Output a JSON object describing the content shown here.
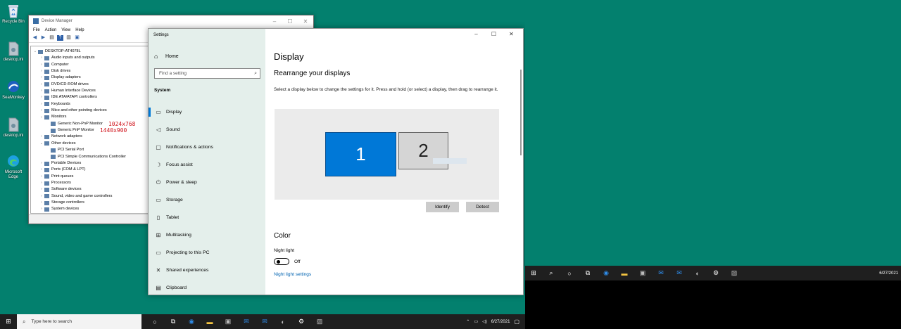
{
  "desktop": {
    "icons": [
      {
        "label": "Recycle Bin",
        "icon": "recycle-bin-icon"
      },
      {
        "label": "desktop.ini",
        "icon": "file-icon"
      },
      {
        "label": "SeaMonkey",
        "icon": "seamonkey-icon"
      },
      {
        "label": "desktop.ini",
        "icon": "file-icon"
      },
      {
        "label": "Microsoft Edge",
        "icon": "edge-icon"
      }
    ]
  },
  "device_manager": {
    "title": "Device Manager",
    "menu": [
      "File",
      "Action",
      "View",
      "Help"
    ],
    "tree": {
      "root": "DESKTOP-AT4078L",
      "items": [
        {
          "label": "Audio inputs and outputs",
          "expanded": false
        },
        {
          "label": "Computer",
          "expanded": false
        },
        {
          "label": "Disk drives",
          "expanded": false
        },
        {
          "label": "Display adapters",
          "expanded": false
        },
        {
          "label": "DVD/CD-ROM drives",
          "expanded": false
        },
        {
          "label": "Human Interface Devices",
          "expanded": false
        },
        {
          "label": "IDE ATA/ATAPI controllers",
          "expanded": false
        },
        {
          "label": "Keyboards",
          "expanded": false
        },
        {
          "label": "Mice and other pointing devices",
          "expanded": false
        },
        {
          "label": "Monitors",
          "expanded": true
        },
        {
          "label": "Generic Non-PnP Monitor",
          "child": true,
          "res": "1024x768"
        },
        {
          "label": "Generic PnP Monitor",
          "child": true,
          "res": "1440x900"
        },
        {
          "label": "Network adapters",
          "expanded": false
        },
        {
          "label": "Other devices",
          "expanded": true
        },
        {
          "label": "PCI Serial Port",
          "child": true
        },
        {
          "label": "PCI Simple Communications Controller",
          "child": true
        },
        {
          "label": "Portable Devices",
          "expanded": false
        },
        {
          "label": "Ports (COM & LPT)",
          "expanded": false
        },
        {
          "label": "Print queues",
          "expanded": false
        },
        {
          "label": "Processors",
          "expanded": false
        },
        {
          "label": "Software devices",
          "expanded": false
        },
        {
          "label": "Sound, video and game controllers",
          "expanded": false
        },
        {
          "label": "Storage controllers",
          "expanded": false
        },
        {
          "label": "System devices",
          "expanded": false
        }
      ]
    }
  },
  "settings": {
    "window_title": "Settings",
    "nav": {
      "home": "Home",
      "search_placeholder": "Find a setting",
      "section": "System",
      "items": [
        {
          "label": "Display",
          "icon": "monitor-icon",
          "glyph": "▭",
          "active": true
        },
        {
          "label": "Sound",
          "icon": "speaker-icon",
          "glyph": "◁",
          "active": false
        },
        {
          "label": "Notifications & actions",
          "icon": "notification-icon",
          "glyph": "▢",
          "active": false
        },
        {
          "label": "Focus assist",
          "icon": "moon-icon",
          "glyph": "☽",
          "active": false
        },
        {
          "label": "Power & sleep",
          "icon": "power-icon",
          "glyph": "⏻",
          "active": false
        },
        {
          "label": "Storage",
          "icon": "storage-icon",
          "glyph": "▭",
          "active": false
        },
        {
          "label": "Tablet",
          "icon": "tablet-icon",
          "glyph": "▯",
          "active": false
        },
        {
          "label": "Multitasking",
          "icon": "multitasking-icon",
          "glyph": "⊞",
          "active": false
        },
        {
          "label": "Projecting to this PC",
          "icon": "projecting-icon",
          "glyph": "▭",
          "active": false
        },
        {
          "label": "Shared experiences",
          "icon": "shared-icon",
          "glyph": "✕",
          "active": false
        },
        {
          "label": "Clipboard",
          "icon": "clipboard-icon",
          "glyph": "▤",
          "active": false
        }
      ]
    },
    "content": {
      "title": "Display",
      "subtitle": "Rearrange your displays",
      "description": "Select a display below to change the settings for it. Press and hold (or select) a display, then drag to rearrange it.",
      "display_1": "1",
      "display_2": "2",
      "identify_label": "Identify",
      "detect_label": "Detect",
      "color_heading": "Color",
      "night_light_label": "Night light",
      "night_light_state": "Off",
      "night_light_link": "Night light settings"
    }
  },
  "taskbar": {
    "search_placeholder": "Type here to search",
    "date": "6/27/2021",
    "pinned": [
      {
        "icon": "cortana-icon",
        "glyph": "○"
      },
      {
        "icon": "task-view-icon",
        "glyph": "⧉"
      },
      {
        "icon": "edge-icon",
        "glyph": "◉"
      },
      {
        "icon": "file-explorer-icon",
        "glyph": "▬"
      },
      {
        "icon": "store-icon",
        "glyph": "▣"
      },
      {
        "icon": "mail-icon",
        "glyph": "✉"
      },
      {
        "icon": "mail-icon",
        "glyph": "✉"
      },
      {
        "icon": "seamonkey-icon",
        "glyph": "◐"
      },
      {
        "icon": "settings-gear-icon",
        "glyph": "⚙"
      },
      {
        "icon": "device-manager-icon",
        "glyph": "▨"
      }
    ]
  },
  "taskbar2": {
    "date": "6/27/2021"
  },
  "colors": {
    "desktop": "#03806e",
    "accent": "#0078d7",
    "nav_bg": "#e4efeb",
    "resolution_label": "#d0131b"
  }
}
